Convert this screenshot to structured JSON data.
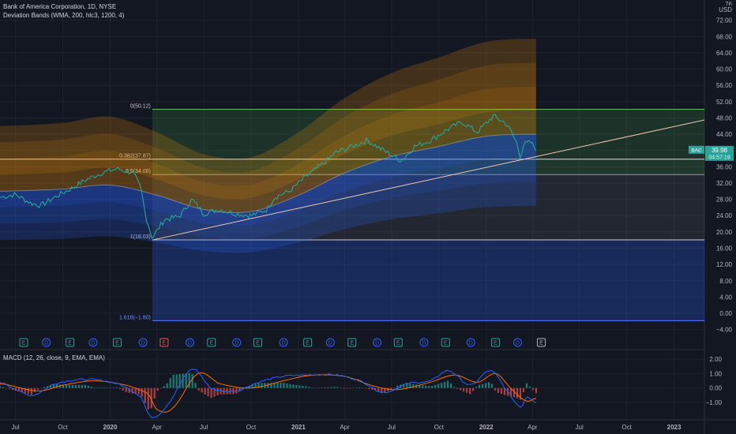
{
  "header": {
    "symbol_title": "Bank of America Corporation, 1D, NYSE",
    "indicator_label": "Deviation Bands (WMA, 200, hlc3, 1200, 4)",
    "currency": "USD",
    "top_tick_partial": "76"
  },
  "macd": {
    "label": "MACD (12, 26, close, 9, EMA, EMA)"
  },
  "price_tag": {
    "symbol": "BAC",
    "price": "39.98",
    "countdown": "04:57:19"
  },
  "colors": {
    "background": "#131722",
    "grid": "#1e222d",
    "axis_text": "#b2b5be",
    "price": "#26a69a",
    "price_down": "#ef5350",
    "macd_line": "#2962ff",
    "signal_line": "#ff6d00",
    "trendline": "#f0c8b4",
    "band_orange": "#ff9800",
    "band_blue": "#2962ff",
    "fib_green": "#4caf50",
    "fib_blue": "#2962ff"
  },
  "chart_data": {
    "type": "line",
    "price_axis": {
      "ticks": [
        72,
        68,
        64,
        60,
        56,
        52,
        48,
        44,
        40,
        36,
        32,
        28,
        24,
        20,
        16,
        12,
        8,
        4,
        0,
        -4
      ],
      "labels": [
        "72.00",
        "68.00",
        "64.00",
        "60.00",
        "56.00",
        "52.00",
        "48.00",
        "44.00",
        "40.00",
        "36.00",
        "32.00",
        "28.00",
        "24.00",
        "20.00",
        "16.00",
        "12.00",
        "8.00",
        "4.00",
        "0.00",
        "−4.00"
      ],
      "ylim": [
        -6,
        76
      ]
    },
    "macd_axis": {
      "ticks": [
        2,
        1,
        0,
        -1
      ],
      "labels": [
        "2.00",
        "1.00",
        "0.00",
        "−1.00"
      ],
      "ylim": [
        -2.2,
        2.5
      ]
    },
    "time_axis": {
      "xlim": [
        "2019-06-01",
        "2023-03-01"
      ],
      "ticks": [
        {
          "date": "2019-07-01",
          "label": "Jul"
        },
        {
          "date": "2019-10-01",
          "label": "Oct"
        },
        {
          "date": "2020-01-01",
          "label": "2020"
        },
        {
          "date": "2020-04-01",
          "label": "Apr"
        },
        {
          "date": "2020-07-01",
          "label": "Jul"
        },
        {
          "date": "2020-10-01",
          "label": "Oct"
        },
        {
          "date": "2021-01-01",
          "label": "2021"
        },
        {
          "date": "2021-04-01",
          "label": "Apr"
        },
        {
          "date": "2021-07-01",
          "label": "Jul"
        },
        {
          "date": "2021-10-01",
          "label": "Oct"
        },
        {
          "date": "2022-01-01",
          "label": "2022"
        },
        {
          "date": "2022-04-01",
          "label": "Apr"
        },
        {
          "date": "2022-07-01",
          "label": "Jul"
        },
        {
          "date": "2022-10-01",
          "label": "Oct"
        },
        {
          "date": "2023-01-01",
          "label": "2023"
        }
      ]
    },
    "price_series": {
      "name": "BAC",
      "x": [
        "2019-06-01",
        "2019-07-01",
        "2019-08-01",
        "2019-08-20",
        "2019-09-15",
        "2019-10-15",
        "2019-11-15",
        "2019-12-15",
        "2020-01-15",
        "2020-02-15",
        "2020-03-01",
        "2020-03-10",
        "2020-03-23",
        "2020-04-15",
        "2020-05-15",
        "2020-06-08",
        "2020-07-01",
        "2020-08-01",
        "2020-09-01",
        "2020-10-01",
        "2020-11-01",
        "2020-11-15",
        "2020-12-15",
        "2021-01-15",
        "2021-02-15",
        "2021-03-15",
        "2021-04-15",
        "2021-05-15",
        "2021-06-15",
        "2021-07-20",
        "2021-08-15",
        "2021-09-15",
        "2021-10-15",
        "2021-11-15",
        "2021-12-15",
        "2022-01-15",
        "2022-02-10",
        "2022-03-01",
        "2022-03-08",
        "2022-03-15",
        "2022-03-29",
        "2022-04-08"
      ],
      "y": [
        28.5,
        29.2,
        27.0,
        26.5,
        28.5,
        30.5,
        32.8,
        34.5,
        35.5,
        34.5,
        30.5,
        24.0,
        18.5,
        23.0,
        23.8,
        28.0,
        24.5,
        25.5,
        24.5,
        24.0,
        25.5,
        28.5,
        30.0,
        33.5,
        36.5,
        39.5,
        41.0,
        42.5,
        40.0,
        37.5,
        41.0,
        42.5,
        45.0,
        47.0,
        44.5,
        48.5,
        46.5,
        42.0,
        38.5,
        41.5,
        42.0,
        39.98
      ]
    },
    "band_center": {
      "x": [
        "2019-06-01",
        "2019-10-01",
        "2020-01-01",
        "2020-04-01",
        "2020-07-01",
        "2020-10-01",
        "2021-01-01",
        "2021-04-01",
        "2021-07-01",
        "2021-10-01",
        "2022-01-01",
        "2022-04-08"
      ],
      "y": [
        30.0,
        30.5,
        31.5,
        29.0,
        25.5,
        25.0,
        29.0,
        34.5,
        38.5,
        41.0,
        43.5,
        44.0
      ]
    },
    "bands": {
      "offsets": [
        -12,
        -8,
        -4,
        4,
        8,
        12,
        16
      ]
    },
    "macd_line": {
      "x": [
        "2019-06-01",
        "2019-08-01",
        "2019-09-15",
        "2019-11-15",
        "2020-01-15",
        "2020-03-01",
        "2020-03-20",
        "2020-04-20",
        "2020-06-08",
        "2020-07-15",
        "2020-09-01",
        "2020-10-15",
        "2020-12-01",
        "2021-01-15",
        "2021-03-15",
        "2021-05-01",
        "2021-06-15",
        "2021-08-01",
        "2021-09-15",
        "2021-10-20",
        "2021-12-01",
        "2022-01-10",
        "2022-02-15",
        "2022-03-10",
        "2022-03-20",
        "2022-04-08"
      ],
      "y": [
        0.4,
        -0.5,
        0.3,
        0.6,
        0.3,
        -0.6,
        -2.0,
        -1.2,
        1.3,
        0.0,
        -0.2,
        0.4,
        0.8,
        0.9,
        0.9,
        0.5,
        -0.3,
        0.3,
        0.5,
        1.2,
        0.2,
        1.2,
        -0.4,
        -1.3,
        -0.6,
        -1.0
      ]
    },
    "signal_line": {
      "x": [
        "2019-06-01",
        "2019-08-15",
        "2019-10-01",
        "2019-12-01",
        "2020-02-01",
        "2020-03-15",
        "2020-04-01",
        "2020-05-01",
        "2020-06-20",
        "2020-08-01",
        "2020-10-01",
        "2020-12-15",
        "2021-02-01",
        "2021-04-01",
        "2021-06-01",
        "2021-07-15",
        "2021-09-15",
        "2021-11-01",
        "2021-12-15",
        "2022-01-20",
        "2022-02-20",
        "2022-03-20",
        "2022-04-08"
      ],
      "y": [
        0.3,
        -0.2,
        0.2,
        0.5,
        0.2,
        -0.4,
        -1.5,
        -1.4,
        1.0,
        0.3,
        0.0,
        0.6,
        0.9,
        0.8,
        0.1,
        -0.1,
        0.4,
        0.9,
        0.4,
        1.0,
        -0.1,
        -0.9,
        -0.7
      ]
    },
    "trendline": {
      "from": {
        "date": "2020-03-23",
        "value": 18.0
      },
      "to": {
        "date": "2023-03-01",
        "value": 47.5
      },
      "solid_until": "2022-04-08"
    },
    "fib": {
      "start": "2020-03-23",
      "end": "2022-04-08",
      "levels": [
        {
          "value": 50.12,
          "label": "0(50.12)"
        },
        {
          "value": 37.87,
          "label": "0.382(37.87)"
        },
        {
          "value": 34.08,
          "label": "0.5(34.08)"
        },
        {
          "value": 18.03,
          "label": "1(18.03)"
        },
        {
          "value": -1.8,
          "label": "1.618(−1.80)"
        }
      ]
    },
    "events": [
      {
        "date": "2019-07-17",
        "type": "E"
      },
      {
        "date": "2019-08-30",
        "type": "D"
      },
      {
        "date": "2019-10-15",
        "type": "E"
      },
      {
        "date": "2019-11-29",
        "type": "D"
      },
      {
        "date": "2020-01-15",
        "type": "E"
      },
      {
        "date": "2020-03-05",
        "type": "D"
      },
      {
        "date": "2020-04-15",
        "type": "E",
        "highlight": true
      },
      {
        "date": "2020-06-04",
        "type": "D"
      },
      {
        "date": "2020-07-16",
        "type": "E"
      },
      {
        "date": "2020-09-03",
        "type": "D"
      },
      {
        "date": "2020-10-14",
        "type": "E"
      },
      {
        "date": "2020-12-03",
        "type": "D"
      },
      {
        "date": "2021-01-19",
        "type": "E"
      },
      {
        "date": "2021-03-04",
        "type": "D"
      },
      {
        "date": "2021-04-15",
        "type": "E"
      },
      {
        "date": "2021-06-03",
        "type": "D"
      },
      {
        "date": "2021-07-14",
        "type": "E"
      },
      {
        "date": "2021-09-02",
        "type": "D"
      },
      {
        "date": "2021-10-14",
        "type": "E"
      },
      {
        "date": "2021-12-02",
        "type": "D"
      },
      {
        "date": "2022-01-19",
        "type": "E"
      },
      {
        "date": "2022-03-03",
        "type": "D"
      },
      {
        "date": "2022-04-18",
        "type": "E",
        "upcoming": true
      }
    ]
  }
}
